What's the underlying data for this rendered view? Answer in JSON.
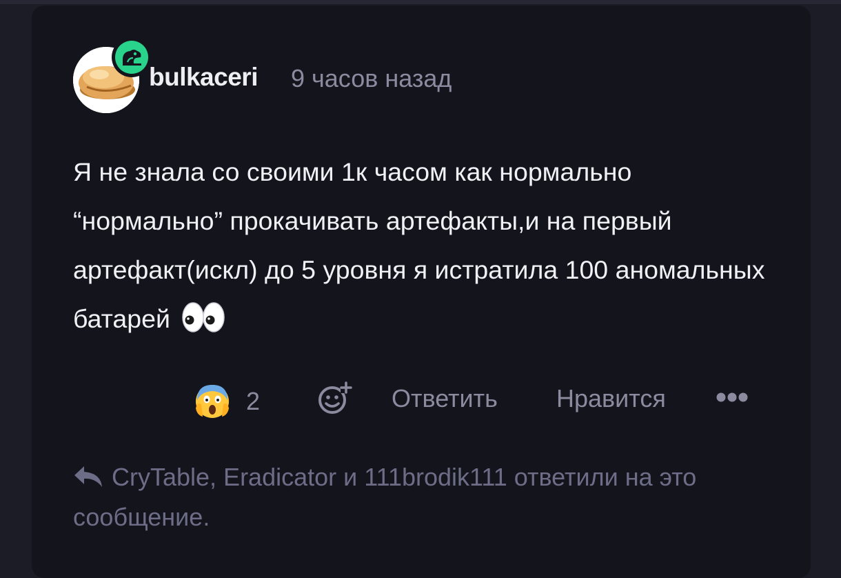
{
  "post": {
    "username": "bulkaceri",
    "timestamp": "9 часов назад",
    "message": "Я не знала со своими 1к часом как нормально “нормально” прокачивать артефакты,и на первый артефакт(искл) до 5 уровня я истратила 100 аномальных батарей",
    "badge_color": "#2ad38b"
  },
  "actions": {
    "reaction_emoji": "😱",
    "reaction_count": "2",
    "reply_label": "Ответить",
    "like_label": "Нравится"
  },
  "replies_summary": "CryTable, Eradicator и 111brodik111 ответили на это сообщение.",
  "icons": [
    "bread-avatar",
    "frog-badge-icon",
    "eyes-emoji",
    "scream-emoji",
    "add-reaction-icon",
    "more-icon",
    "reply-arrow-icon"
  ]
}
